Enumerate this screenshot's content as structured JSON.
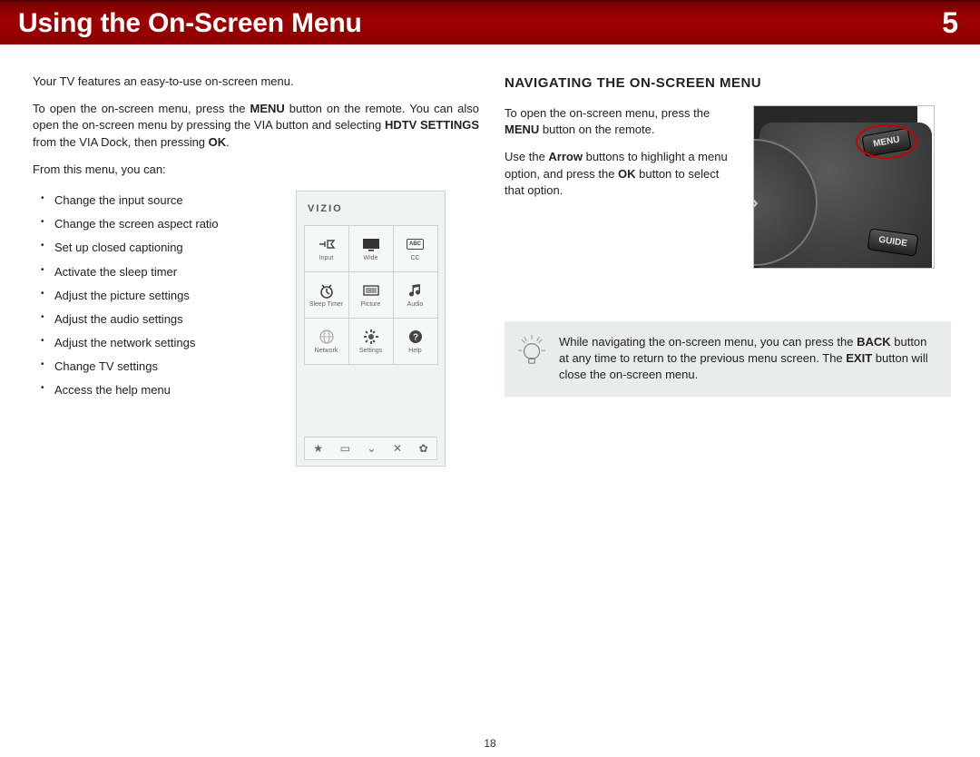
{
  "header": {
    "title": "Using the On-Screen Menu",
    "chapter": "5"
  },
  "left": {
    "intro1": "Your TV features an easy-to-use on-screen menu.",
    "intro2_pre": "To open the on-screen menu, press the ",
    "intro2_b1": "MENU",
    "intro2_mid": " button on the remote. You can also open the on-screen menu by pressing the VIA button and selecting ",
    "intro2_b2": "HDTV SETTINGS",
    "intro2_mid2": " from the VIA Dock, then pressing ",
    "intro2_b3": "OK",
    "intro2_end": ".",
    "intro3": "From this menu, you can:",
    "bullets": [
      "Change the input source",
      "Change the screen aspect ratio",
      "Set up closed captioning",
      "Activate the sleep timer",
      "Adjust the picture settings",
      "Adjust the audio settings",
      "Adjust the network settings",
      "Change TV settings",
      "Access the help menu"
    ]
  },
  "vizio": {
    "logo": "VIZIO",
    "items": [
      {
        "label": "Input"
      },
      {
        "label": "Wide"
      },
      {
        "label": "CC",
        "badge": "ABC"
      },
      {
        "label": "Sleep Timer"
      },
      {
        "label": "Picture"
      },
      {
        "label": "Audio"
      },
      {
        "label": "Network"
      },
      {
        "label": "Settings"
      },
      {
        "label": "Help"
      }
    ],
    "bottom_icons": [
      "★",
      "▭",
      "⌄",
      "✕",
      "✿"
    ]
  },
  "right": {
    "heading": "NAVIGATING THE ON-SCREEN MENU",
    "p1_pre": "To open the on-screen menu, press the ",
    "p1_b1": "MENU",
    "p1_end": " button on the remote.",
    "p2_pre": "Use the ",
    "p2_b1": "Arrow",
    "p2_mid": " buttons to highlight a menu option, and press the ",
    "p2_b2": "OK",
    "p2_end": " button to select that option.",
    "remote": {
      "menu_label": "MENU",
      "guide_label": "GUIDE",
      "arrow": "›"
    }
  },
  "tip": {
    "pre": "While navigating the on-screen menu, you can press the ",
    "b1": "BACK",
    "mid": " button at any time to return to the previous menu screen. The ",
    "b2": "EXIT",
    "end": " button will close the on-screen menu."
  },
  "page_number": "18"
}
